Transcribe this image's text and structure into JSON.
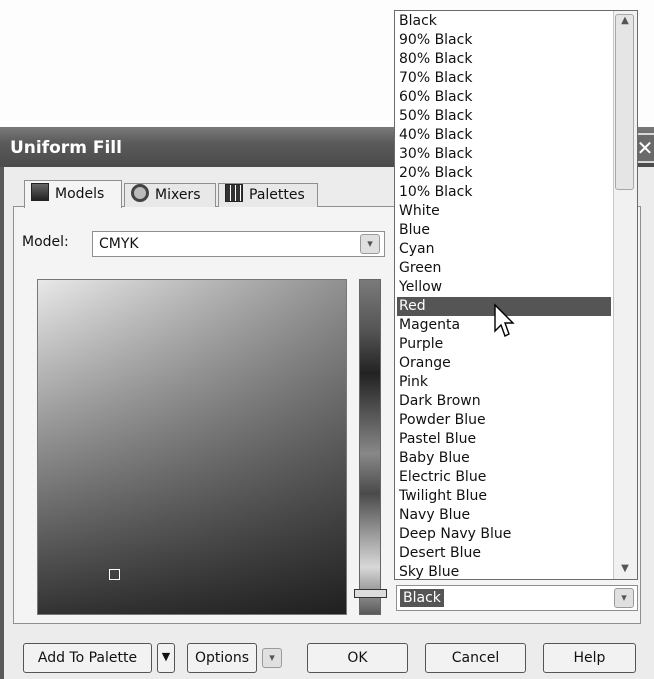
{
  "dialog": {
    "title": "Uniform Fill",
    "close_glyph": "✕"
  },
  "tabs": [
    {
      "label": "Models",
      "icon": "models-icon"
    },
    {
      "label": "Mixers",
      "icon": "mixers-icon"
    },
    {
      "label": "Palettes",
      "icon": "palettes-icon"
    }
  ],
  "model": {
    "label": "Model:",
    "value": "CMYK"
  },
  "palette_list": {
    "items": [
      "Black",
      "90% Black",
      "80% Black",
      "70% Black",
      "60% Black",
      "50% Black",
      "40% Black",
      "30% Black",
      "20% Black",
      "10% Black",
      "White",
      "Blue",
      "Cyan",
      "Green",
      "Yellow",
      "Red",
      "Magenta",
      "Purple",
      "Orange",
      "Pink",
      "Dark Brown",
      "Powder Blue",
      "Pastel Blue",
      "Baby Blue",
      "Electric Blue",
      "Twilight Blue",
      "Navy Blue",
      "Deep Navy Blue",
      "Desert Blue",
      "Sky Blue"
    ],
    "highlighted": "Red",
    "selected_value": "Black"
  },
  "buttons": {
    "add_to_palette": "Add To Palette",
    "options": "Options",
    "ok": "OK",
    "cancel": "Cancel",
    "help": "Help"
  },
  "colors": {
    "title_bar": "#555555",
    "highlight": "#555555"
  }
}
